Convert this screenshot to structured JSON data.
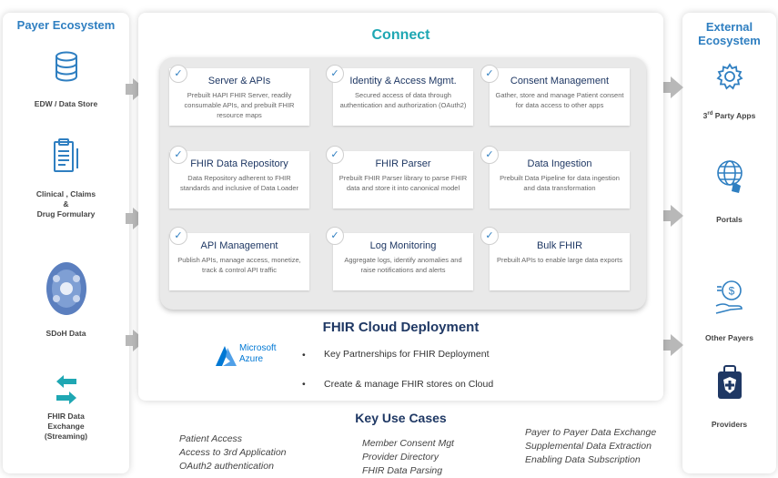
{
  "left": {
    "title": "Payer Ecosystem",
    "items": [
      {
        "label": "EDW / Data Store"
      },
      {
        "label_lines": [
          "Clinical , Claims",
          "&",
          "Drug Formulary"
        ]
      },
      {
        "label": "SDoH Data"
      },
      {
        "label_lines": [
          "FHIR Data",
          "Exchange",
          "(Streaming)"
        ]
      }
    ]
  },
  "right": {
    "title_lines": [
      "External",
      "Ecosystem"
    ],
    "items": [
      {
        "label": "3rd Party Apps",
        "label_sup_prefix": "3",
        "label_sup": "rd",
        "label_rest": " Party Apps"
      },
      {
        "label": "Portals"
      },
      {
        "label": "Other Payers"
      },
      {
        "label": "Providers"
      }
    ]
  },
  "connect": {
    "title": "Connect",
    "cards": [
      {
        "title": "Server & APIs",
        "desc": "Prebuilt HAPI FHIR Server, readily consumable APIs, and prebuilt FHIR resource maps"
      },
      {
        "title": "Identity & Access Mgmt.",
        "desc": "Secured access of data through authentication and authorization (OAuth2)"
      },
      {
        "title": "Consent Management",
        "desc": "Gather, store and manage  Patient consent for data access to other apps"
      },
      {
        "title": "FHIR Data Repository",
        "desc": "Data Repository adherent to FHIR standards and inclusive of Data Loader"
      },
      {
        "title": "FHIR Parser",
        "desc": "Prebuilt FHIR Parser library to parse FHIR data and store it into canonical model"
      },
      {
        "title": "Data Ingestion",
        "desc": "Prebuilt Data Pipeline for data ingestion and data transformation"
      },
      {
        "title": "API Management",
        "desc": "Publish APIs, manage access, monetize, track & control API traffic"
      },
      {
        "title": "Log Monitoring",
        "desc": "Aggregate logs, identify anomalies and raise notifications and alerts"
      },
      {
        "title": "Bulk FHIR",
        "desc": "Prebuilt APIs to enable large data exports"
      }
    ]
  },
  "deployment": {
    "title": "FHIR Cloud Deployment",
    "azure_line1": "Microsoft",
    "azure_line2": "Azure",
    "bullets": [
      "Key Partnerships for FHIR Deployment",
      "Create & manage FHIR stores on Cloud"
    ]
  },
  "usecases": {
    "title": "Key Use Cases",
    "col1": [
      "Patient Access",
      "Access to 3rd Application",
      "OAuth2 authentication"
    ],
    "col2": [
      "Member Consent Mgt",
      "Provider Directory",
      "FHIR Data Parsing"
    ],
    "col3": [
      "Payer to Payer Data Exchange",
      "Supplemental Data Extraction",
      "Enabling Data Subscription"
    ]
  },
  "colors": {
    "blue_title": "#2f7fc1",
    "teal": "#1fa7b3",
    "navy": "#1f3864",
    "arrow": "#b8b8b8"
  }
}
